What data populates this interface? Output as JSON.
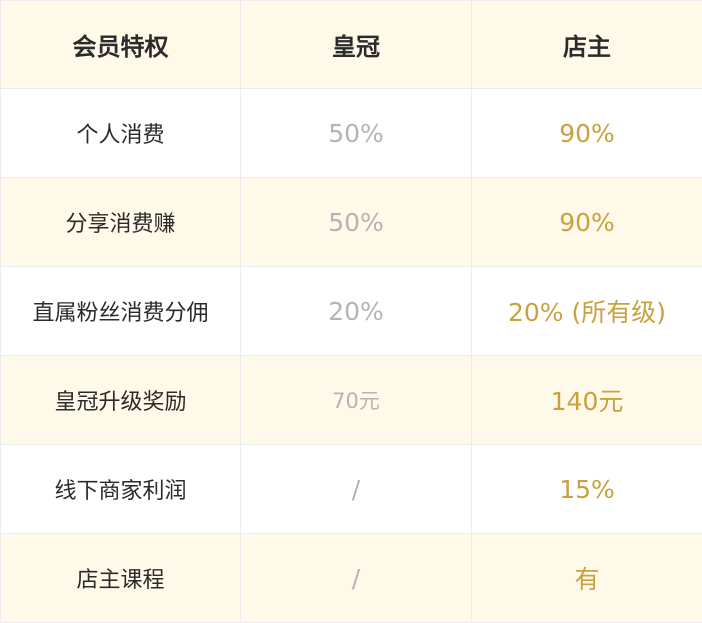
{
  "header": {
    "feature": "会员特权",
    "crown": "皇冠",
    "owner": "店主"
  },
  "rows": [
    {
      "feature": "个人消费",
      "crown": "50%",
      "owner": "90%"
    },
    {
      "feature": "分享消费赚",
      "crown": "50%",
      "owner": "90%"
    },
    {
      "feature": "直属粉丝消费分佣",
      "crown": "20%",
      "owner": "20% (所有级)"
    },
    {
      "feature": "皇冠升级奖励",
      "crown": "70元",
      "owner": "140元"
    },
    {
      "feature": "线下商家利润",
      "crown": "/",
      "owner": "15%"
    },
    {
      "feature": "店主课程",
      "crown": "/",
      "owner": "有"
    }
  ],
  "colors": {
    "highlight_row": "#fff9e9",
    "owner_gold": "#c9a23f",
    "crown_gray": "#b4b4b4",
    "text_dark": "#2b2b2b",
    "border": "#ececec"
  }
}
